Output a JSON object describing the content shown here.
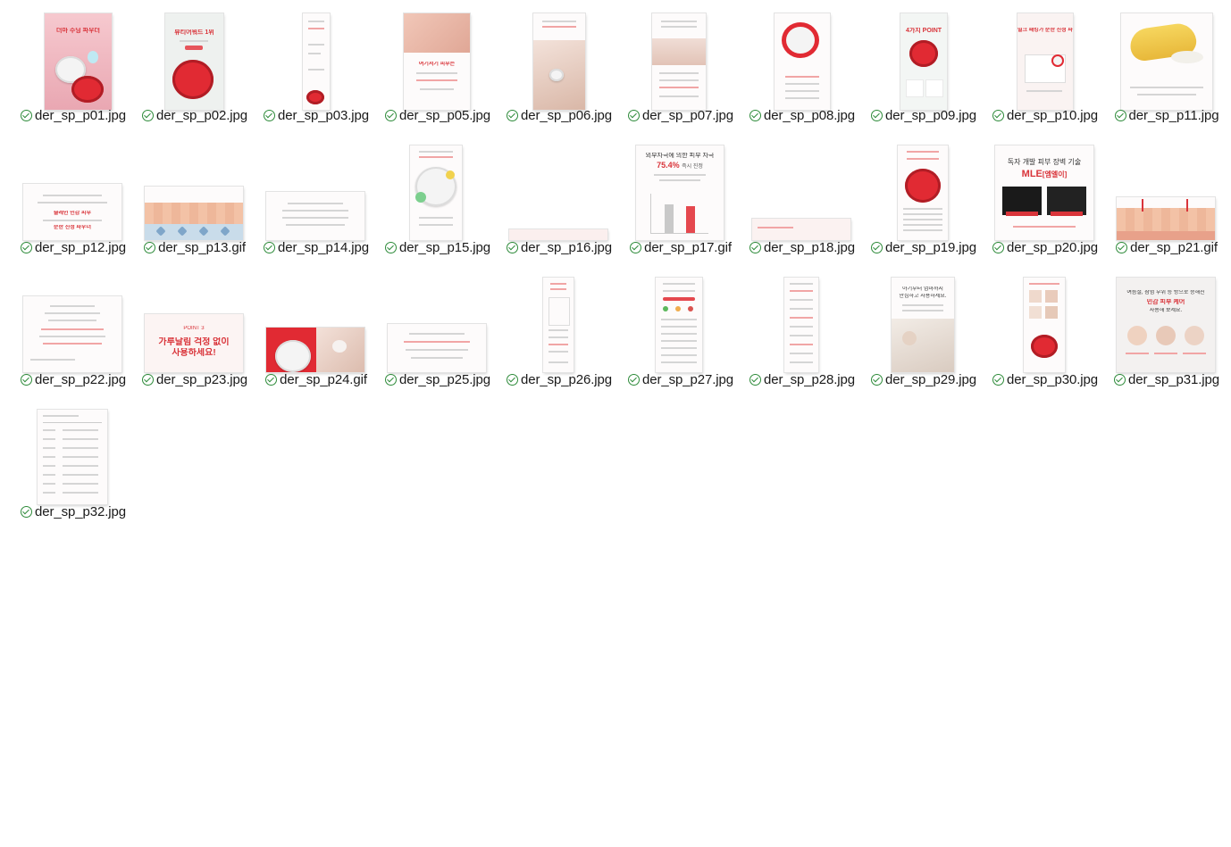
{
  "files": [
    {
      "name": "der_sp_p01.jpg",
      "status": "synced"
    },
    {
      "name": "der_sp_p02.jpg",
      "status": "synced"
    },
    {
      "name": "der_sp_p03.jpg",
      "status": "synced"
    },
    {
      "name": "der_sp_p05.jpg",
      "status": "synced"
    },
    {
      "name": "der_sp_p06.jpg",
      "status": "synced"
    },
    {
      "name": "der_sp_p07.jpg",
      "status": "synced"
    },
    {
      "name": "der_sp_p08.jpg",
      "status": "synced"
    },
    {
      "name": "der_sp_p09.jpg",
      "status": "synced"
    },
    {
      "name": "der_sp_p10.jpg",
      "status": "synced"
    },
    {
      "name": "der_sp_p11.jpg",
      "status": "synced"
    },
    {
      "name": "der_sp_p12.jpg",
      "status": "synced"
    },
    {
      "name": "der_sp_p13.gif",
      "status": "synced"
    },
    {
      "name": "der_sp_p14.jpg",
      "status": "synced"
    },
    {
      "name": "der_sp_p15.jpg",
      "status": "synced"
    },
    {
      "name": "der_sp_p16.jpg",
      "status": "synced"
    },
    {
      "name": "der_sp_p17.gif",
      "status": "synced"
    },
    {
      "name": "der_sp_p18.jpg",
      "status": "synced"
    },
    {
      "name": "der_sp_p19.jpg",
      "status": "synced"
    },
    {
      "name": "der_sp_p20.jpg",
      "status": "synced"
    },
    {
      "name": "der_sp_p21.gif",
      "status": "synced"
    },
    {
      "name": "der_sp_p22.jpg",
      "status": "synced"
    },
    {
      "name": "der_sp_p23.jpg",
      "status": "synced"
    },
    {
      "name": "der_sp_p24.gif",
      "status": "synced"
    },
    {
      "name": "der_sp_p25.jpg",
      "status": "synced"
    },
    {
      "name": "der_sp_p26.jpg",
      "status": "synced"
    },
    {
      "name": "der_sp_p27.jpg",
      "status": "synced"
    },
    {
      "name": "der_sp_p28.jpg",
      "status": "synced"
    },
    {
      "name": "der_sp_p29.jpg",
      "status": "synced"
    },
    {
      "name": "der_sp_p30.jpg",
      "status": "synced"
    },
    {
      "name": "der_sp_p31.jpg",
      "status": "synced"
    },
    {
      "name": "der_sp_p32.jpg",
      "status": "synced"
    }
  ],
  "thumbs": {
    "p01": {
      "title": "더마 수딩 파우더"
    },
    "p02": {
      "title": "뷰티어워드 1위"
    },
    "p05": {
      "title": "여기저기 피부는"
    },
    "p09": {
      "title": "4가지 POINT"
    },
    "p10": {
      "title": "밀크 패킹가 순한 진정 파우더"
    },
    "p12": {
      "line1": "슬레인 민감 피부",
      "line2": "순한 진정 파우더"
    },
    "p17": {
      "line1": "외부자극에 의한 피부 자극",
      "line2": "75.4%",
      "line3": "즉시 진정"
    },
    "p20": {
      "line1": "독자 개발 피부 장벽 기술",
      "line2": "MLE",
      "line3": "[엠엘이]"
    },
    "p23": {
      "line1": "POINT 3",
      "line2": "가루날림 걱정 없이",
      "line3": "사용하세요!"
    },
    "p29": {
      "line1": "아기부터 엄마까지",
      "line2": "안심하고 사용하세요."
    },
    "p31": {
      "line1": "여름철, 잠험 부위 등 방으로 승해진",
      "line2": "민감 피부 케어",
      "line3": "사용해 보세요."
    }
  }
}
